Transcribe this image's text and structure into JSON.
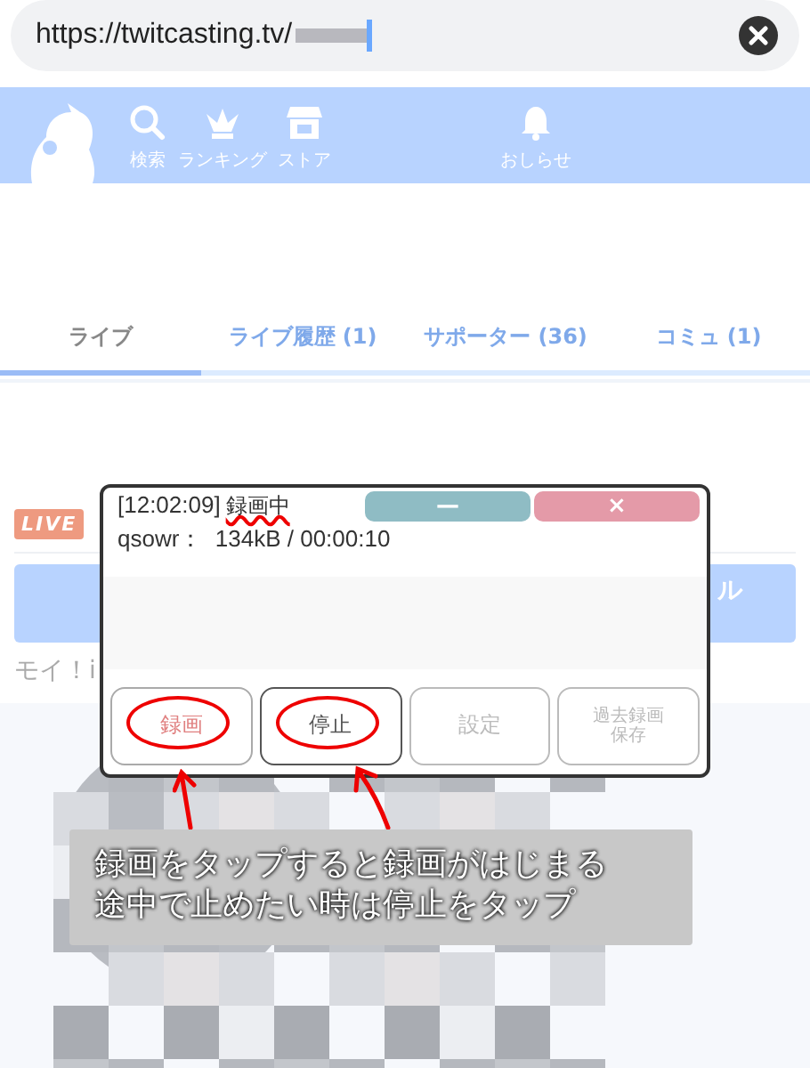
{
  "address_bar": {
    "url": "https://twitcasting.tv/"
  },
  "nav": [
    {
      "label": "検索"
    },
    {
      "label": "ランキング"
    },
    {
      "label": "ストア"
    },
    {
      "label": "おしらせ"
    }
  ],
  "tabs": [
    {
      "label": "ライブ",
      "selected": true
    },
    {
      "label": "ライブ履歴 (1)",
      "selected": false
    },
    {
      "label": "サポーター (36)",
      "selected": false
    },
    {
      "label": "コミュ (1)",
      "selected": false
    }
  ],
  "live_badge": "LIVE",
  "blue_button": "ル",
  "comment_text": "モイ！i",
  "recorder": {
    "minimize": "—",
    "close": "×",
    "time": "[12:02:09]",
    "status": "録画中",
    "status_underlined": true,
    "info": "qsowr：  134kB / 00:00:10",
    "buttons": [
      {
        "lines": [
          "録画"
        ],
        "kind": "record",
        "disabled": false,
        "circled": true
      },
      {
        "lines": [
          "停止"
        ],
        "kind": "normal",
        "disabled": false,
        "circled": true
      },
      {
        "lines": [
          "設定"
        ],
        "kind": "normal",
        "disabled": true,
        "circled": false
      },
      {
        "lines": [
          "過去録画",
          "保存"
        ],
        "kind": "small",
        "disabled": true,
        "circled": false
      }
    ]
  },
  "caption": [
    "録画をタップすると録画がはじまる",
    "途中で止めたい時は停止をタップ"
  ]
}
